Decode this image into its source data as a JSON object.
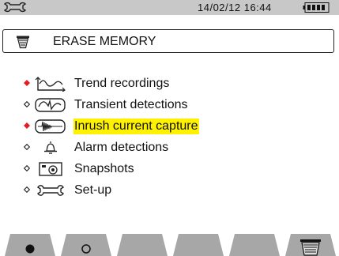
{
  "status_bar": {
    "datetime": "14/02/12 16:44"
  },
  "header": {
    "title": "ERASE MEMORY"
  },
  "menu": {
    "items": [
      {
        "label": "Trend recordings",
        "selected": true,
        "icon": "trend-curve-icon"
      },
      {
        "label": "Transient detections",
        "selected": false,
        "icon": "transient-waveform-icon"
      },
      {
        "label": "Inrush current capture",
        "selected": true,
        "highlighted": true,
        "icon": "inrush-waveform-icon"
      },
      {
        "label": "Alarm detections",
        "selected": false,
        "icon": "alarm-bell-icon"
      },
      {
        "label": "Snapshots",
        "selected": false,
        "icon": "camera-icon"
      },
      {
        "label": "Set-up",
        "selected": false,
        "icon": "wrench-icon"
      }
    ]
  },
  "softkeys": [
    {
      "icon": "filled-circle-icon"
    },
    {
      "icon": "hollow-circle-icon"
    },
    {
      "icon": "blank"
    },
    {
      "icon": "blank"
    },
    {
      "icon": "blank"
    },
    {
      "icon": "trash-icon"
    }
  ],
  "colors": {
    "selected_bullet": "#e31b23",
    "highlight": "#fff200",
    "status_bar": "#c8c8c8",
    "softkey": "#a7a7a7"
  }
}
